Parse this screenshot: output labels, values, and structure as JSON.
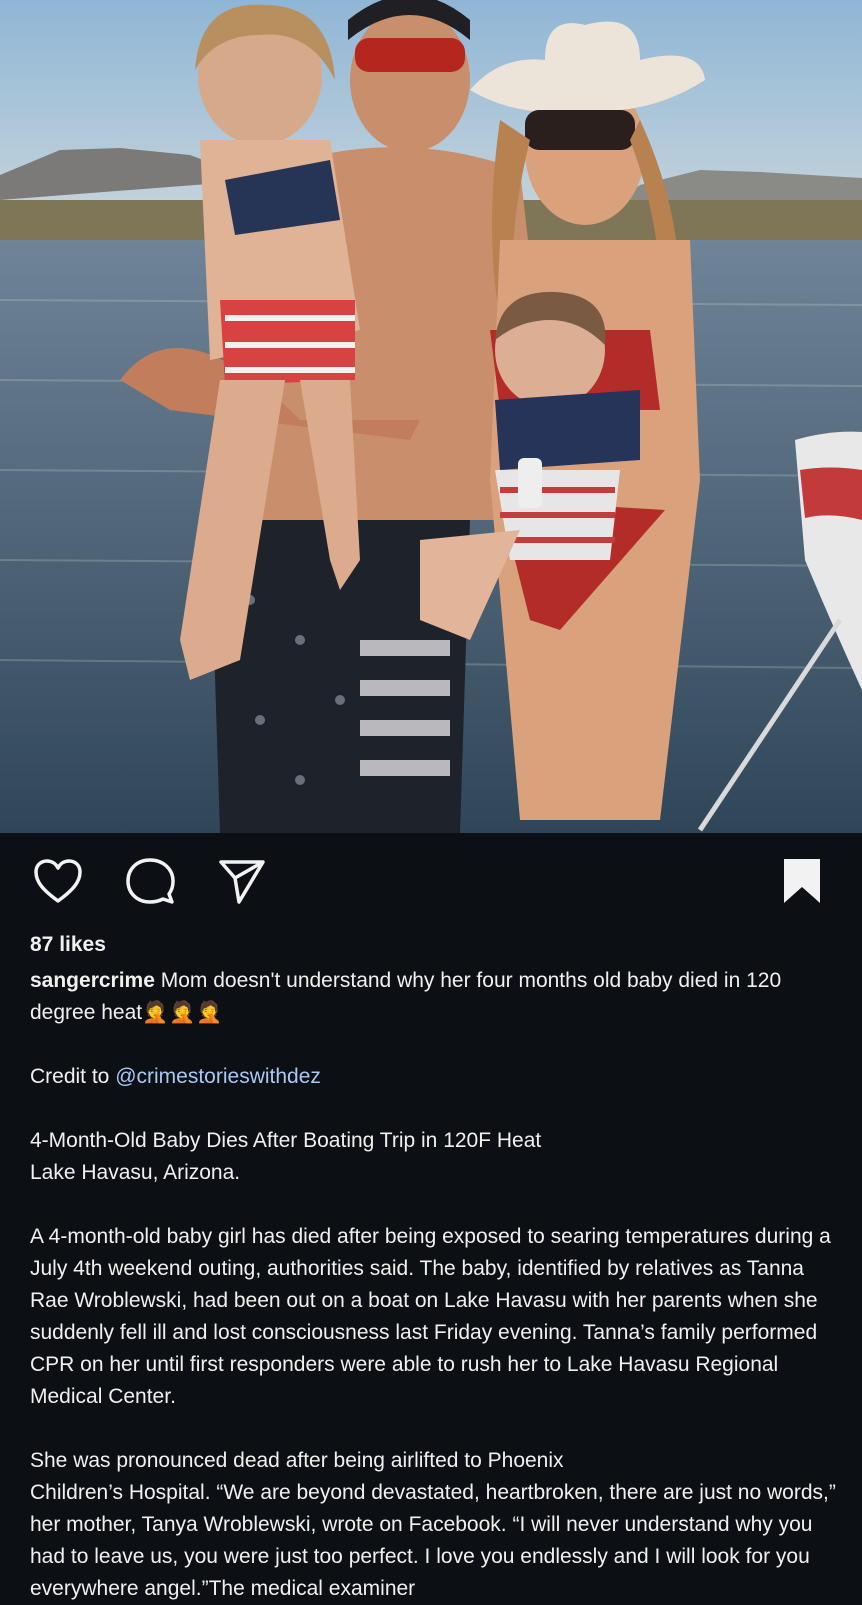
{
  "post": {
    "photo_alt": "",
    "likes_label": "87 likes",
    "username": "sangercrime",
    "caption_first": "Mom doesn't understand why her four months old baby died in 120 degree heat",
    "caption_emojis": "🤦🤦🤦",
    "credit_prefix": "Credit to ",
    "credit_mention": "@crimestorieswithdez",
    "headline_line1": "4-Month-Old Baby Dies After Boating Trip in 120F Heat",
    "headline_line2": "Lake Havasu, Arizona.",
    "paragraph1": "A 4-month-old baby girl has died after being exposed to searing temperatures during a July 4th weekend outing, authorities said. The baby, identified by relatives as Tanna Rae Wroblewski, had been out on a boat on Lake Havasu with her parents when she suddenly fell ill and lost consciousness last Friday evening. Tanna’s family performed CPR on her until first responders were able to rush her to Lake Havasu Regional Medical Center.",
    "paragraph2_line1": "She was pronounced dead after being airlifted to Phoenix",
    "paragraph2_rest": "Children’s Hospital. “We are beyond devastated, heartbroken, there are just no words,” her mother, Tanya Wroblewski, wrote on Facebook. “I will never understand why you had to leave us, you were just too perfect. I love you endlessly and I will look for you everywhere angel.”The medical examiner"
  },
  "icons": {
    "like": "heart-icon",
    "comment": "comment-bubble-icon",
    "share": "paper-plane-icon",
    "save": "bookmark-icon"
  },
  "colors": {
    "background": "#0c0f14",
    "text": "#f0f0f0",
    "mention": "#a9c8f5"
  }
}
